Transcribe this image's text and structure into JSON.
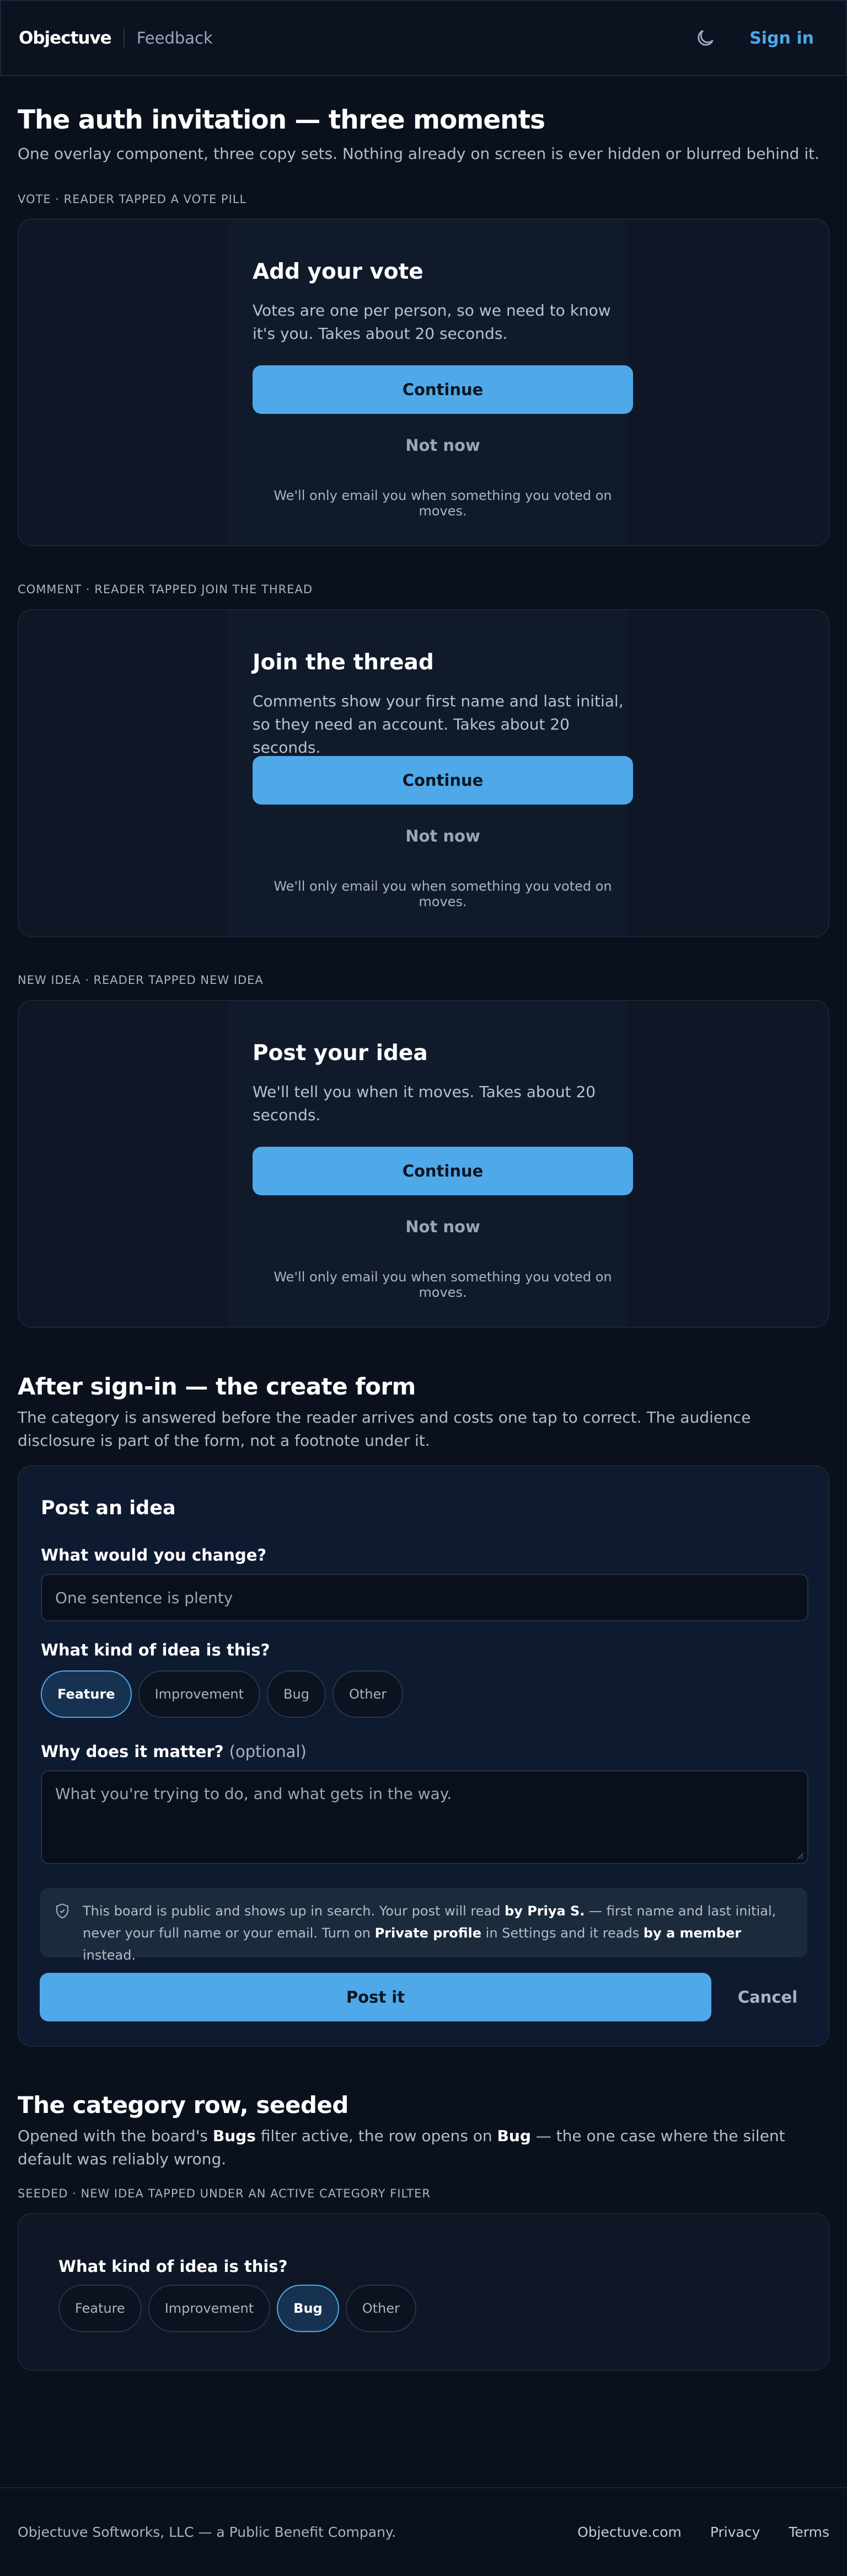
{
  "header": {
    "logo": "Objectuve",
    "nav_feedback": "Feedback",
    "theme_icon": "moon-icon",
    "sign_in": "Sign in"
  },
  "intro": {
    "title": "The auth invitation — three moments",
    "subtitle": "One overlay component, three copy sets. Nothing already on screen is ever hidden or blurred behind it."
  },
  "moments": [
    {
      "eyebrow": "VOTE · READER TAPPED A VOTE PILL",
      "title": "Add your vote",
      "body": "Votes are one per person, so we need to know it's you. Takes about 20 seconds.",
      "continue": "Continue",
      "not_now": "Not now",
      "fine_print": "We'll only email you when something you voted on moves."
    },
    {
      "eyebrow": "COMMENT · READER TAPPED JOIN THE THREAD",
      "title": "Join the thread",
      "body": "Comments show your first name and last initial, so they need an account. Takes about 20 seconds.",
      "continue": "Continue",
      "not_now": "Not now",
      "fine_print": "We'll only email you when something you voted on moves."
    },
    {
      "eyebrow": "NEW IDEA · READER TAPPED NEW IDEA",
      "title": "Post your idea",
      "body": "We'll tell you when it moves. Takes about 20 seconds.",
      "continue": "Continue",
      "not_now": "Not now",
      "fine_print": "We'll only email you when something you voted on moves."
    }
  ],
  "create": {
    "section_title": "After sign-in — the create form",
    "section_sub": "The category is answered before the reader arrives and costs one tap to correct. The audience disclosure is part of the form, not a footnote under it.",
    "form_title": "Post an idea",
    "q_change": "What would you change?",
    "change_placeholder": "One sentence is plenty",
    "q_kind": "What kind of idea is this?",
    "categories": [
      "Feature",
      "Improvement",
      "Bug",
      "Other"
    ],
    "selected_category": "Feature",
    "q_why": "Why does it matter?",
    "q_why_optional": "(optional)",
    "why_placeholder": "What you're trying to do, and what gets in the way.",
    "disclosure": {
      "icon": "shield-icon",
      "p1": "This board is public and shows up in search. Your post will read ",
      "name": "by Priya S.",
      "p2": " — first name and last initial, never your full name or your email. Turn on ",
      "private": "Private profile",
      "p3": " in Settings and it reads ",
      "member": "by a member",
      "p4": " instead."
    },
    "post_button": "Post it",
    "cancel_button": "Cancel"
  },
  "seeded": {
    "section_title": "The category row, seeded",
    "sub_p1": "Opened with the board's ",
    "sub_bugs": "Bugs",
    "sub_p2": " filter active, the row opens on ",
    "sub_bug": "Bug",
    "sub_p3": " — the one case where the silent default was reliably wrong.",
    "eyebrow": "SEEDED · NEW IDEA TAPPED UNDER AN ACTIVE CATEGORY FILTER",
    "q_kind": "What kind of idea is this?",
    "categories": [
      "Feature",
      "Improvement",
      "Bug",
      "Other"
    ],
    "selected_category": "Bug"
  },
  "footer": {
    "company": "Objectuve Softworks, LLC — a Public Benefit Company.",
    "links": [
      "Objectuve.com",
      "Privacy",
      "Terms"
    ]
  },
  "colors": {
    "background": "#0b111c",
    "accent": "#4fa9e8",
    "card": "#0f1726"
  }
}
